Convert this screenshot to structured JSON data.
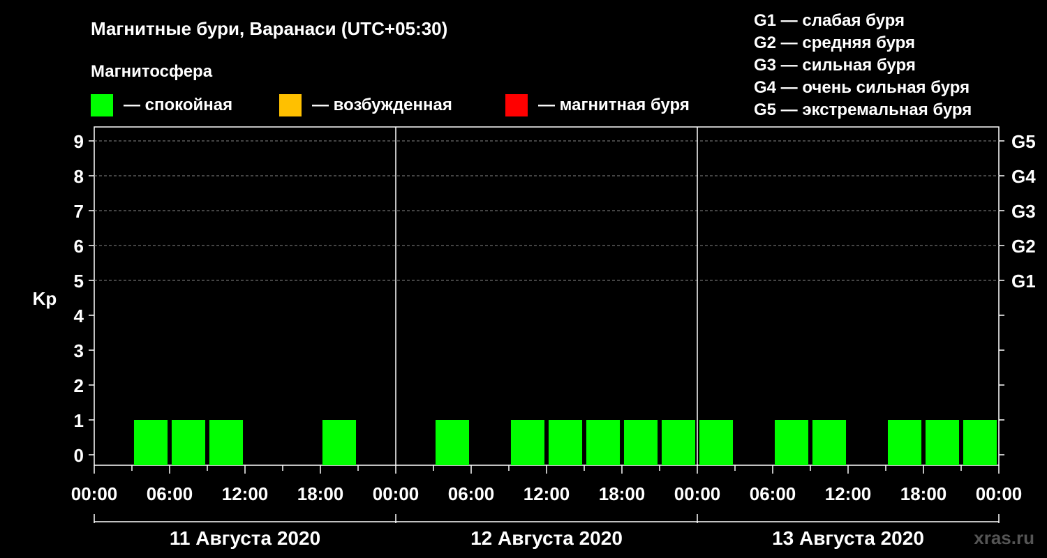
{
  "chart_data": {
    "type": "bar",
    "title": "Магнитные бури, Варанаси (UTC+05:30)",
    "ylabel": "Kp",
    "ylim": [
      0,
      9
    ],
    "yticks": [
      "0",
      "1",
      "2",
      "3",
      "4",
      "5",
      "6",
      "7",
      "8",
      "9"
    ],
    "storm_levels": [
      {
        "kp": 5,
        "label": "G1"
      },
      {
        "kp": 6,
        "label": "G2"
      },
      {
        "kp": 7,
        "label": "G3"
      },
      {
        "kp": 8,
        "label": "G4"
      },
      {
        "kp": 9,
        "label": "G5"
      }
    ],
    "x_tick_labels": [
      "00:00",
      "06:00",
      "12:00",
      "18:00",
      "00:00",
      "06:00",
      "12:00",
      "18:00",
      "00:00",
      "06:00",
      "12:00",
      "18:00",
      "00:00"
    ],
    "days": [
      "11 Августа 2020",
      "12 Августа 2020",
      "13 Августа 2020"
    ],
    "bar_interval_hours": 3,
    "values": [
      0,
      1,
      1,
      1,
      0,
      0,
      1,
      0,
      0,
      1,
      0,
      1,
      1,
      1,
      1,
      1,
      1,
      0,
      1,
      1,
      0,
      1,
      1,
      1
    ],
    "grid": "dashed at Kp 5–9",
    "legend": {
      "heading": "Магнитосфера",
      "items": [
        {
          "label": "— спокойная",
          "color": "#00ff00"
        },
        {
          "label": "— возбужденная",
          "color": "#ffc000"
        },
        {
          "label": "— магнитная буря",
          "color": "#ff0000"
        }
      ],
      "scale": [
        "G1 — слабая буря",
        "G2 — средняя буря",
        "G3 — сильная буря",
        "G4 — очень сильная буря",
        "G5 — экстремальная буря"
      ]
    }
  },
  "watermark": "xras.ru",
  "colors": {
    "background": "#000000",
    "axis": "#ffffff",
    "quiet": "#00ff00",
    "grid": "#888888"
  }
}
